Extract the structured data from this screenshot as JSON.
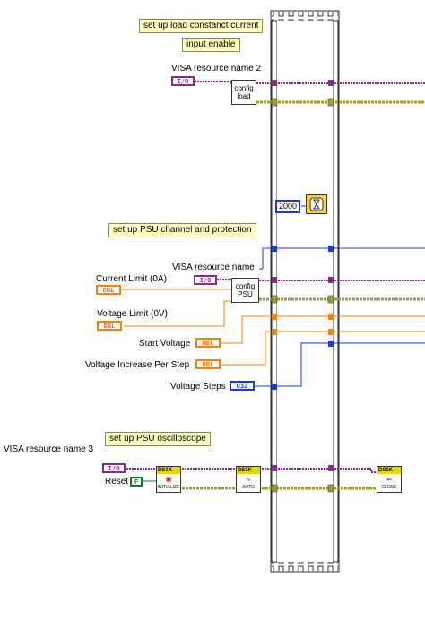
{
  "notes": {
    "load": "set up load constanct current",
    "input_enable": "input enable",
    "psu": "set up PSU channel and protection",
    "osc": "set up PSU oscilloscope"
  },
  "labels": {
    "visa2": "VISA resource name 2",
    "visa_psu": "VISA resource name",
    "current_limit": "Current Limit (0A)",
    "voltage_limit": "Voltage Limit (0V)",
    "start_voltage": "Start Voltage",
    "voltage_increase": "Voltage Increase Per Step",
    "voltage_steps": "Voltage Steps",
    "visa3": "VISA resource name 3",
    "reset": "Reset"
  },
  "terminals": {
    "visa": "I/O",
    "dbl": "DBL",
    "u32": "U32",
    "bool_false": "F"
  },
  "subvis": {
    "config_load": "config\nload",
    "config_psu": "config\nPSU",
    "ds_brand": "DS1K",
    "initialize": "INITIALIZE",
    "auto": "AUTO",
    "close": "CLOSE"
  },
  "constants": {
    "wait_ms": "2000"
  },
  "colors": {
    "visa_wire": "#8b2a8b",
    "error_wire": "#9e9e2e",
    "dbl_wire": "#ff8000",
    "u32_wire": "#1e3ad6",
    "note_bg": "#ffffc0"
  },
  "icons": {
    "wait": "wait-clock-icon",
    "frame": "film-frame-icon"
  }
}
